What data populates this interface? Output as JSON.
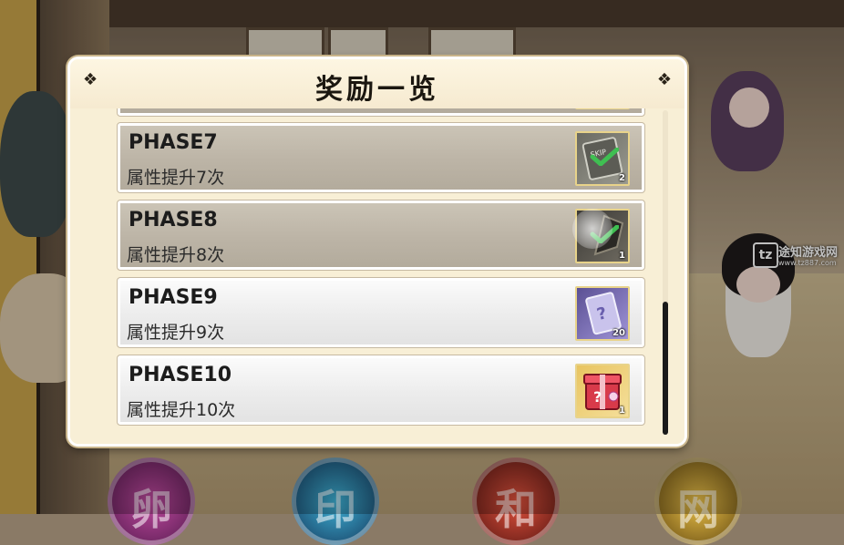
{
  "dialog": {
    "title": "奖励一览",
    "corner_icon": "diamond-ornament-icon"
  },
  "rewards": [
    {
      "title": "PHASE7",
      "desc": "属性提升7次",
      "status": "claimed",
      "item": "skip-ticket-icon",
      "count": "2"
    },
    {
      "title": "PHASE8",
      "desc": "属性提升8次",
      "status": "claimed",
      "item": "gift-box-icon",
      "count": "1"
    },
    {
      "title": "PHASE9",
      "desc": "属性提升9次",
      "status": "unclaimed",
      "item": "mystery-book-icon",
      "count": "20"
    },
    {
      "title": "PHASE10",
      "desc": "属性提升10次",
      "status": "unclaimed",
      "item": "mystery-crate-icon",
      "count": "1"
    }
  ],
  "scroll": {
    "position_fraction": 0.6
  },
  "watermark": {
    "logo": "tz",
    "name": "途知游戏网",
    "url": "www.tz887.com"
  },
  "colors": {
    "dialog_bg": "#fbf3dd",
    "claimed_row": "#bcb4a6",
    "unclaimed_row": "#ececec",
    "check_green": "#3fbf52"
  }
}
